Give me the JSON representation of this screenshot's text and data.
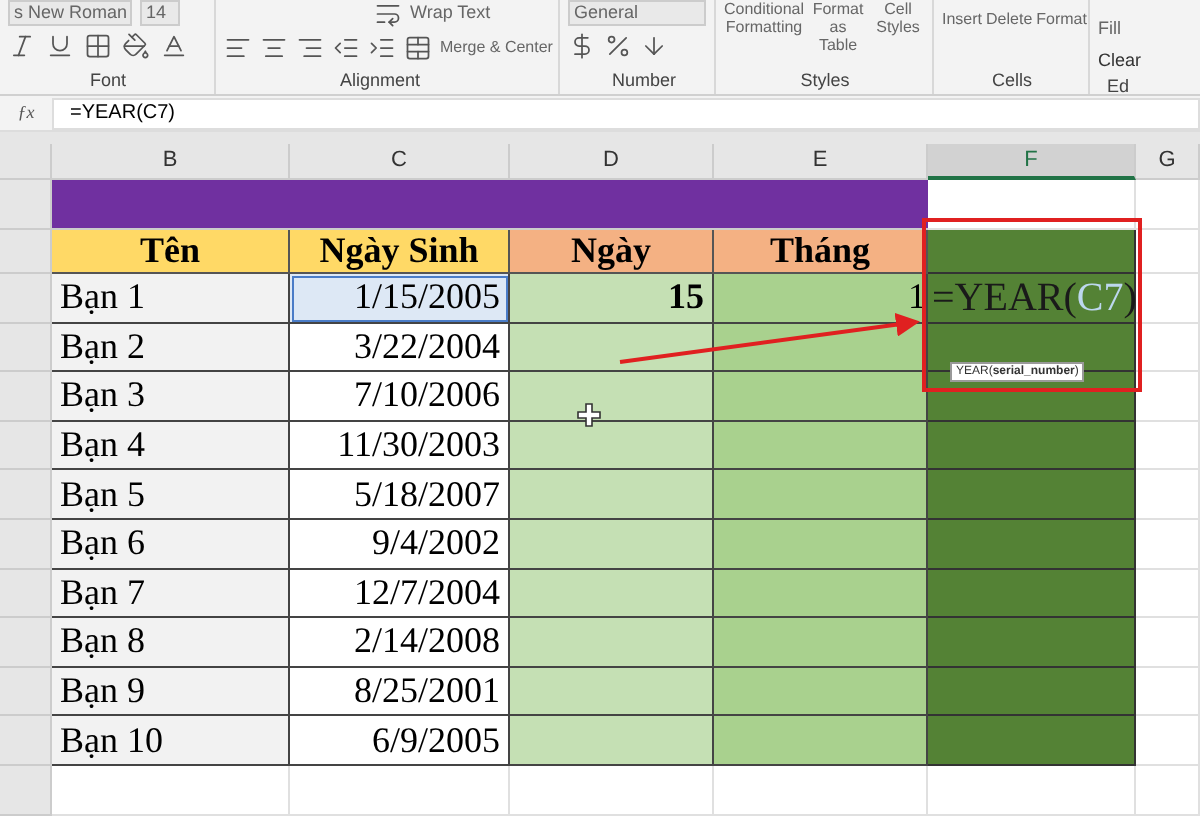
{
  "ribbon": {
    "font_name": "s New Roman",
    "font_size": "14",
    "wrap_text": "Wrap Text",
    "merge_center": "Merge & Center",
    "number_format": "General",
    "styles": [
      {
        "label": "Conditional Formatting"
      },
      {
        "label": "Format as Table"
      },
      {
        "label": "Cell Styles"
      }
    ],
    "cells": [
      {
        "label": "Insert"
      },
      {
        "label": "Delete"
      },
      {
        "label": "Format"
      }
    ],
    "editing": [
      {
        "label": "Fill"
      },
      {
        "label": "Clear"
      }
    ],
    "groups": [
      "Font",
      "Alignment",
      "Number",
      "Styles",
      "Cells",
      "Ed"
    ]
  },
  "formula_bar": {
    "fx": "ƒx",
    "formula": "=YEAR(C7)"
  },
  "sheet": {
    "columns": [
      {
        "label": "B",
        "selected": false
      },
      {
        "label": "C",
        "selected": false
      },
      {
        "label": "D",
        "selected": false
      },
      {
        "label": "E",
        "selected": false
      },
      {
        "label": "F",
        "selected": true
      },
      {
        "label": "G",
        "selected": false
      }
    ],
    "headers": [
      "Tên",
      "Ngày Sinh",
      "Ngày",
      "Tháng"
    ],
    "rows": [
      {
        "name": "Bạn 1",
        "date": "1/15/2005",
        "day": "15",
        "month": "1",
        "date_selected": true
      },
      {
        "name": "Bạn 2",
        "date": "3/22/2004",
        "date_selected": false
      },
      {
        "name": "Bạn 3",
        "date": "7/10/2006",
        "date_selected": false
      },
      {
        "name": "Bạn 4",
        "date": "11/30/2003",
        "date_selected": false
      },
      {
        "name": "Bạn 5",
        "date": "5/18/2007",
        "date_selected": false
      },
      {
        "name": "Bạn 6",
        "date": "9/4/2002",
        "date_selected": false
      },
      {
        "name": "Bạn 7",
        "date": "12/7/2004",
        "date_selected": false
      },
      {
        "name": "Bạn 8",
        "date": "2/14/2008",
        "date_selected": false
      },
      {
        "name": "Bạn 9",
        "date": "8/25/2001",
        "date_selected": false
      },
      {
        "name": "Bạn 10",
        "date": "6/9/2005",
        "date_selected": false
      }
    ],
    "edit_cell": {
      "prefix": "=YEAR(",
      "reference": "C7",
      "suffix": ")"
    },
    "tooltip": "YEAR(**serial_number**)"
  }
}
